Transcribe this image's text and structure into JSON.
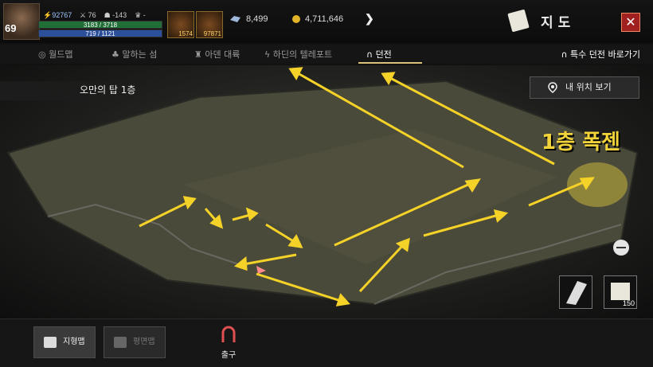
{
  "player": {
    "level": "69",
    "power": "92767",
    "stat_a": "76",
    "stat_b": "-143",
    "stat_c": "-",
    "hp": "3183 / 3718",
    "mp": "719 / 1121"
  },
  "items": [
    {
      "name": "potion-icon",
      "qty": "1574"
    },
    {
      "name": "feather-icon",
      "qty": "97871"
    }
  ],
  "currency": {
    "crystal": "8,499",
    "gold": "4,711,646"
  },
  "window": {
    "title": "지도",
    "close": "✕"
  },
  "tabs": [
    {
      "label": "월드맵",
      "icon": "globe-icon"
    },
    {
      "label": "말하는 섬",
      "icon": "tree-icon"
    },
    {
      "label": "아덴 대륙",
      "icon": "castle-icon"
    },
    {
      "label": "하딘의 텔레포트",
      "icon": "lightning-icon"
    },
    {
      "label": "던전",
      "icon": "arch-icon",
      "active": true
    }
  ],
  "special_dungeon": "특수 던전 바로가기",
  "map": {
    "floor": "오만의 탑 1층",
    "my_location": "내 위치 보기",
    "boss_label": "1층 폭젠",
    "skill_qty": "150",
    "accent_color": "#f2d43a"
  },
  "bottom": {
    "terrain_map": "지형맵",
    "flat_map": "평면맵",
    "exit": "출구"
  }
}
